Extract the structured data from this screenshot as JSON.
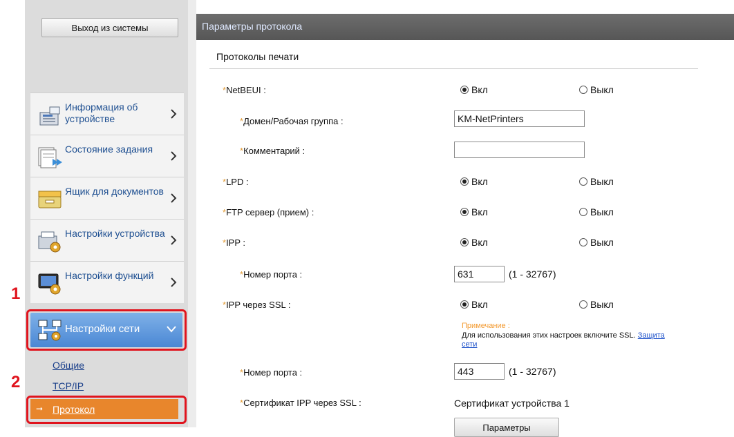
{
  "sidebar": {
    "logout_label": "Выход из системы",
    "menu": [
      {
        "label": "Информация об устройстве",
        "icon": "device-info-icon"
      },
      {
        "label": "Состояние задания",
        "icon": "job-status-icon"
      },
      {
        "label": "Ящик для документов",
        "icon": "document-box-icon"
      },
      {
        "label": "Настройки устройства",
        "icon": "device-settings-icon"
      },
      {
        "label": "Настройки функций",
        "icon": "function-settings-icon"
      }
    ],
    "network": {
      "label": "Настройки сети",
      "icon": "network-settings-icon",
      "expanded": true
    },
    "submenu": [
      {
        "label": "Общие"
      },
      {
        "label": "TCP/IP"
      },
      {
        "label": "Протокол",
        "selected": true
      }
    ]
  },
  "callouts": {
    "step1": "1",
    "step2": "2"
  },
  "panel": {
    "title": "Параметры протокола",
    "section": "Протоколы печати",
    "fields": {
      "netbeui": {
        "label": "NetBEUI :",
        "on": "Вкл",
        "off": "Выкл",
        "value": "on"
      },
      "domain": {
        "label": "Домен/Рабочая группа :",
        "value": "KM-NetPrinters"
      },
      "comment": {
        "label": "Комментарий :",
        "value": ""
      },
      "lpd": {
        "label": "LPD :",
        "on": "Вкл",
        "off": "Выкл",
        "value": "on"
      },
      "ftp": {
        "label": "FTP сервер (прием) :",
        "on": "Вкл",
        "off": "Выкл",
        "value": "on"
      },
      "ipp": {
        "label": "IPP :",
        "on": "Вкл",
        "off": "Выкл",
        "value": "on"
      },
      "ipp_port": {
        "label": "Номер порта :",
        "value": "631",
        "range": "(1 - 32767)"
      },
      "ipp_ssl": {
        "label": "IPP через SSL :",
        "on": "Вкл",
        "off": "Выкл",
        "value": "on"
      },
      "ssl_port": {
        "label": "Номер порта :",
        "value": "443",
        "range": "(1 - 32767)"
      },
      "ssl_cert": {
        "label": "Сертификат IPP через SSL :",
        "value": "Сертификат устройства 1"
      }
    },
    "note": {
      "title": "Примечание :",
      "text": "Для использования этих настроек включите SSL.",
      "link": "Защита сети"
    },
    "params_button": "Параметры"
  },
  "colors": {
    "accent_orange": "#e8862c",
    "callout_red": "#e0141e",
    "nav_blue": "#4a87d4",
    "required_mark": "#e29c38"
  }
}
